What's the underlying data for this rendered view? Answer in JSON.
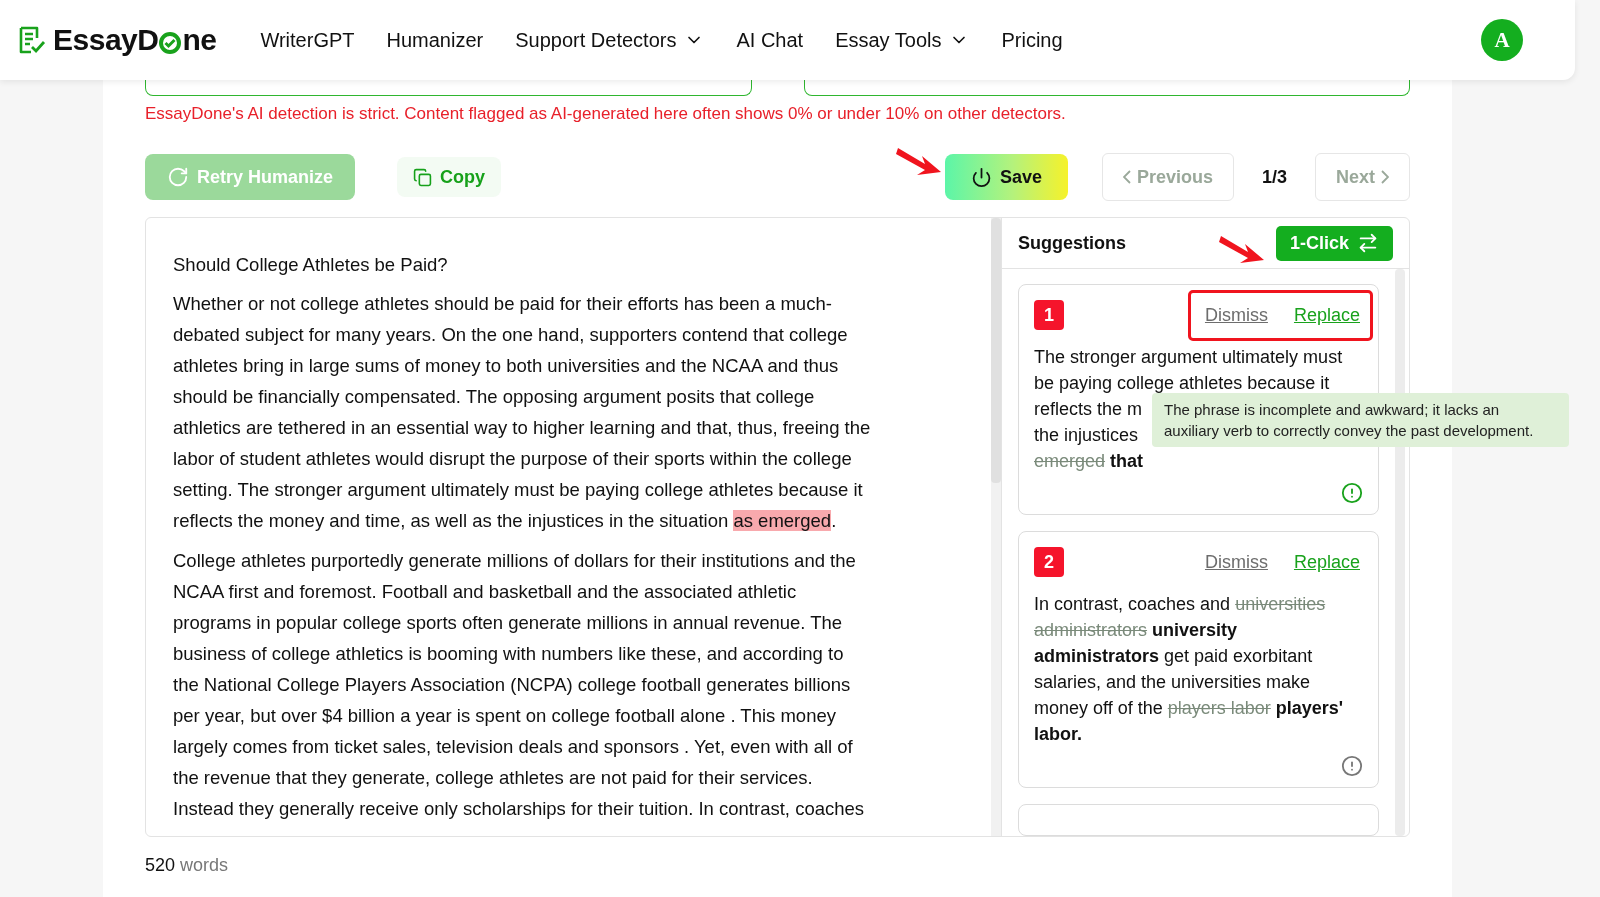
{
  "header": {
    "logo_start": "EssayD",
    "logo_end": "ne",
    "nav": [
      {
        "label": "WriterGPT",
        "dropdown": false
      },
      {
        "label": "Humanizer",
        "dropdown": false
      },
      {
        "label": "Support Detectors",
        "dropdown": true
      },
      {
        "label": "AI Chat",
        "dropdown": false
      },
      {
        "label": "Essay Tools",
        "dropdown": true
      },
      {
        "label": "Pricing",
        "dropdown": false
      }
    ],
    "avatar": "A"
  },
  "notice": "EssayDone's AI detection is strict. Content flagged as AI-generated here often shows 0% or under 10% on other detectors.",
  "toolbar": {
    "retry": {
      "label": "Retry Humanize",
      "disabled": true
    },
    "copy": {
      "label": "Copy"
    },
    "save": {
      "label": "Save",
      "arrow": true
    },
    "previous": {
      "label": "Previous",
      "disabled": true
    },
    "page": "1/3",
    "next": {
      "label": "Next",
      "disabled": true
    }
  },
  "essay": {
    "title": "Should College Athletes be Paid?",
    "paragraphs": [
      [
        "Whether or not college athletes should be paid for their efforts has been a much-",
        "debated subject for many years. On the one hand, supporters contend that college",
        "athletes bring in large sums of money to both universities and the NCAA and thus",
        "should be financially compensated. The opposing argument posits that college",
        "athletics are tethered in an essential way to higher learning and that, thus, freeing the",
        "labor of student athletes would disrupt the purpose of their sports within the college",
        "setting. The stronger argument ultimately must be paying college athletes because it",
        [
          {
            "kind": "plain",
            "text": "reflects the money and time, as well as the injustices in the situation "
          },
          {
            "kind": "highlight",
            "text": "as emerged"
          },
          {
            "kind": "plain",
            "text": "."
          }
        ]
      ],
      [
        "College athletes purportedly generate millions of dollars for their institutions and the",
        "NCAA first and foremost. Football and basketball and the associated athletic",
        "programs in popular college sports often generate millions in annual revenue. The",
        "business of college athletics is booming with numbers like these, and according to",
        "the National College Players Association (NCPA) college football generates billions",
        "per year, but over $4 billion a year is spent on college football alone . This money",
        "largely comes from ticket sales, television deals and sponsors . Yet, even with all of",
        "the revenue that they generate, college athletes are not paid for their services.",
        "Instead they generally receive only scholarships for their tuition. In contrast, coaches"
      ]
    ]
  },
  "word_count": {
    "number": "520",
    "unit": "words"
  },
  "suggestions": {
    "title": "Suggestions",
    "one_click": {
      "label": "1-Click",
      "arrow": true
    },
    "items": [
      {
        "number": "1",
        "dismiss": "Dismiss",
        "replace": "Replace",
        "framed": true,
        "tooltip_open": true,
        "tooltip": "The phrase is incomplete and awkward; it lacks an auxiliary verb to correctly convey the past development.",
        "lines": [
          [
            {
              "kind": "plain",
              "text": "The stronger argument ultimately must"
            }
          ],
          [
            {
              "kind": "plain",
              "text": "be paying college athletes because it"
            }
          ],
          [
            {
              "kind": "plain",
              "text": "reflects the m"
            }
          ],
          [
            {
              "kind": "plain",
              "text": "the injustices"
            }
          ],
          [
            {
              "kind": "removed",
              "text": "emerged"
            },
            {
              "kind": "added",
              "text": " that"
            }
          ]
        ]
      },
      {
        "number": "2",
        "dismiss": "Dismiss",
        "replace": "Replace",
        "framed": false,
        "tooltip_open": false,
        "lines": [
          [
            {
              "kind": "plain",
              "text": "In contrast, coaches and "
            },
            {
              "kind": "removed",
              "text": "universities"
            }
          ],
          [
            {
              "kind": "removed",
              "text": "administrators"
            },
            {
              "kind": "added",
              "text": " university"
            }
          ],
          [
            {
              "kind": "added",
              "text": "administrators"
            },
            {
              "kind": "plain",
              "text": " get paid exorbitant"
            }
          ],
          [
            {
              "kind": "plain",
              "text": "salaries, and the universities make"
            }
          ],
          [
            {
              "kind": "plain",
              "text": "money off of the "
            },
            {
              "kind": "removed",
              "text": "players labor"
            },
            {
              "kind": "added",
              "text": " players'"
            }
          ],
          [
            {
              "kind": "added",
              "text": "labor."
            }
          ]
        ]
      }
    ]
  }
}
